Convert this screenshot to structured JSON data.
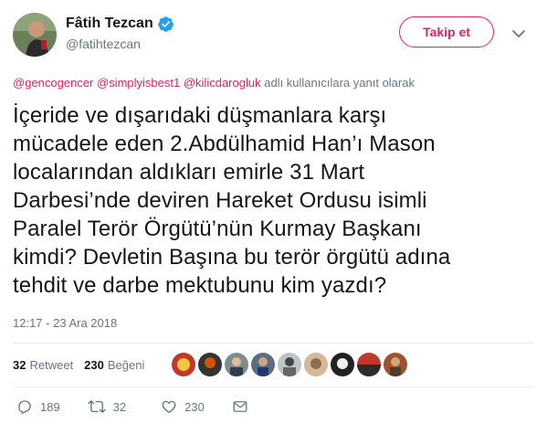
{
  "author": {
    "display_name": "Fâtih Tezcan",
    "handle": "@fatihtezcan"
  },
  "follow_button": "Takip et",
  "reply_context": {
    "mentions": [
      "@gencogencer",
      "@simplyisbest1",
      "@kilicdarogluk"
    ],
    "suffix": "adlı kullanıcılara yanıt olarak"
  },
  "tweet": {
    "lines": [
      "İçeride ve dışarıdaki düşmanlara karşı",
      "mücadele eden 2.Abdülhamid Han’ı Mason",
      "localarından aldıkları emirle 31 Mart",
      "Darbesi’nde deviren Hareket Ordusu isimli",
      "Paralel Terör Örgütü’nün Kurmay Başkanı",
      "kimdi? Devletin Başına bu terör örgütü adına",
      "tehdit ve darbe mektubunu kim yazdı?"
    ],
    "timestamp": "12:17 - 23 Ara 2018"
  },
  "stats": {
    "retweet_count": "32",
    "retweet_label": "Retweet",
    "like_count": "230",
    "like_label": "Beğeni"
  },
  "actions": {
    "reply_count": "189",
    "retweet_count": "32",
    "like_count": "230"
  },
  "colors": {
    "accent": "#e0245e",
    "verified": "#1da1f2",
    "muted": "#657786",
    "text": "#14171a",
    "divider": "#e6ecf0"
  },
  "icons": [
    "verified-badge-icon",
    "chevron-down-icon",
    "reply-icon",
    "retweet-icon",
    "heart-icon",
    "direct-message-icon"
  ]
}
